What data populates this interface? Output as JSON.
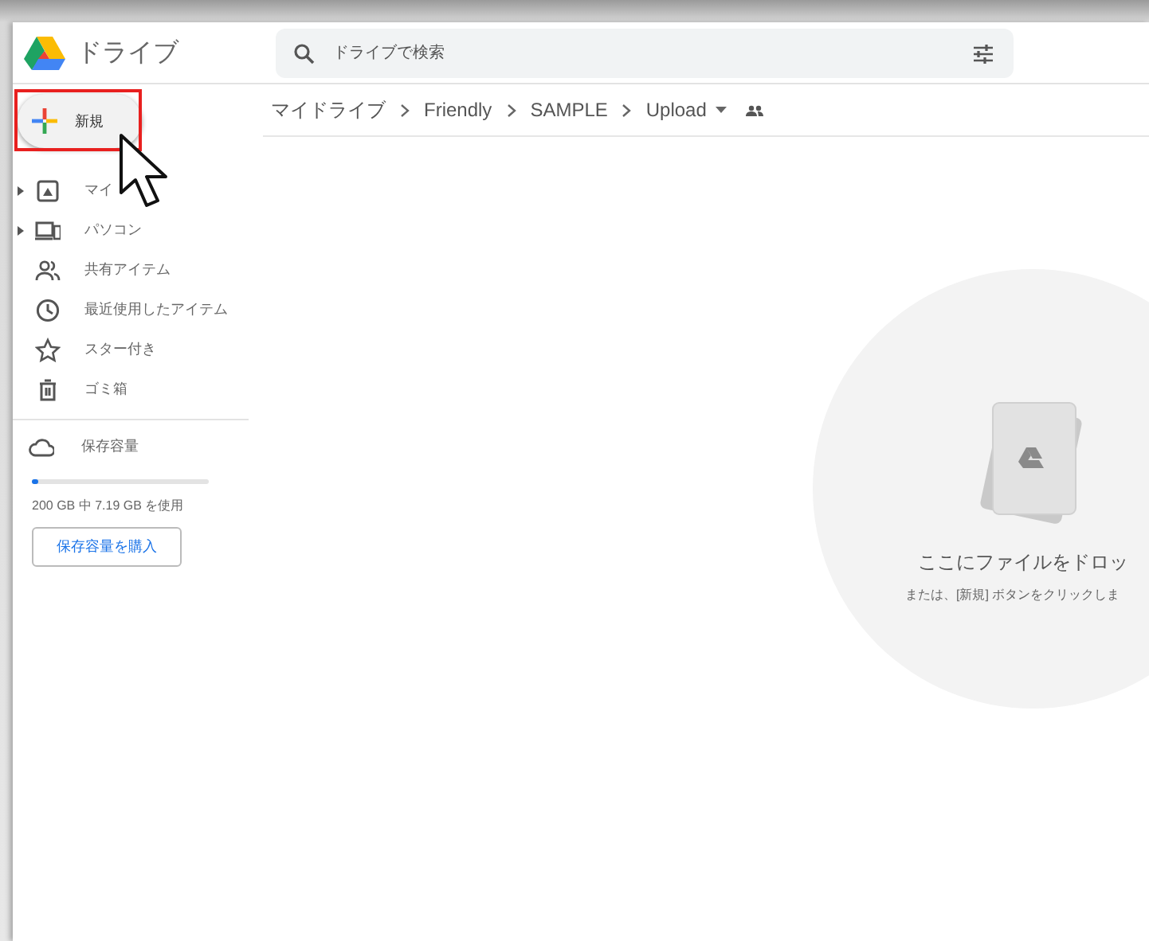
{
  "app": {
    "title": "ドライブ"
  },
  "search": {
    "placeholder": "ドライブで検索"
  },
  "new_button": {
    "label": "新規",
    "highlighted": true
  },
  "breadcrumb": [
    {
      "label": "マイドライブ"
    },
    {
      "label": "Friendly"
    },
    {
      "label": "SAMPLE"
    },
    {
      "label": "Upload",
      "dropdown": true
    }
  ],
  "sidebar": {
    "items": [
      {
        "kind": "drive",
        "label": "マイ",
        "expandable": true
      },
      {
        "kind": "computer",
        "label": "パソコン",
        "expandable": true
      },
      {
        "kind": "shared",
        "label": "共有アイテム",
        "expandable": false
      },
      {
        "kind": "recent",
        "label": "最近使用したアイテム",
        "expandable": false
      },
      {
        "kind": "starred",
        "label": "スター付き",
        "expandable": false
      },
      {
        "kind": "trash",
        "label": "ゴミ箱",
        "expandable": false
      }
    ]
  },
  "storage": {
    "label": "保存容量",
    "level": 0.036,
    "usage": "200 GB 中 7.19 GB を使用",
    "button": "保存容量を購入"
  },
  "drop_zone": {
    "title": "ここにファイルをドロッ",
    "hint": "または、[新規] ボタンをクリックしま"
  }
}
